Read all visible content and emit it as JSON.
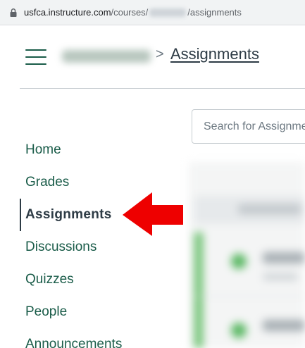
{
  "browser": {
    "url_host": "usfca.instructure.com",
    "url_prefix": "/courses/",
    "url_suffix": "/assignments"
  },
  "header": {
    "breadcrumb_separator": ">",
    "current_page": "Assignments"
  },
  "search": {
    "placeholder": "Search for Assignment"
  },
  "nav": {
    "items": [
      {
        "label": "Home"
      },
      {
        "label": "Grades"
      },
      {
        "label": "Assignments",
        "active": true
      },
      {
        "label": "Discussions"
      },
      {
        "label": "Quizzes"
      },
      {
        "label": "People"
      },
      {
        "label": "Announcements"
      }
    ]
  },
  "annotation": {
    "arrow_color": "#ee0000",
    "arrow_direction": "left"
  },
  "colors": {
    "nav_link": "#1a5c49",
    "nav_active": "#2d3b45"
  }
}
